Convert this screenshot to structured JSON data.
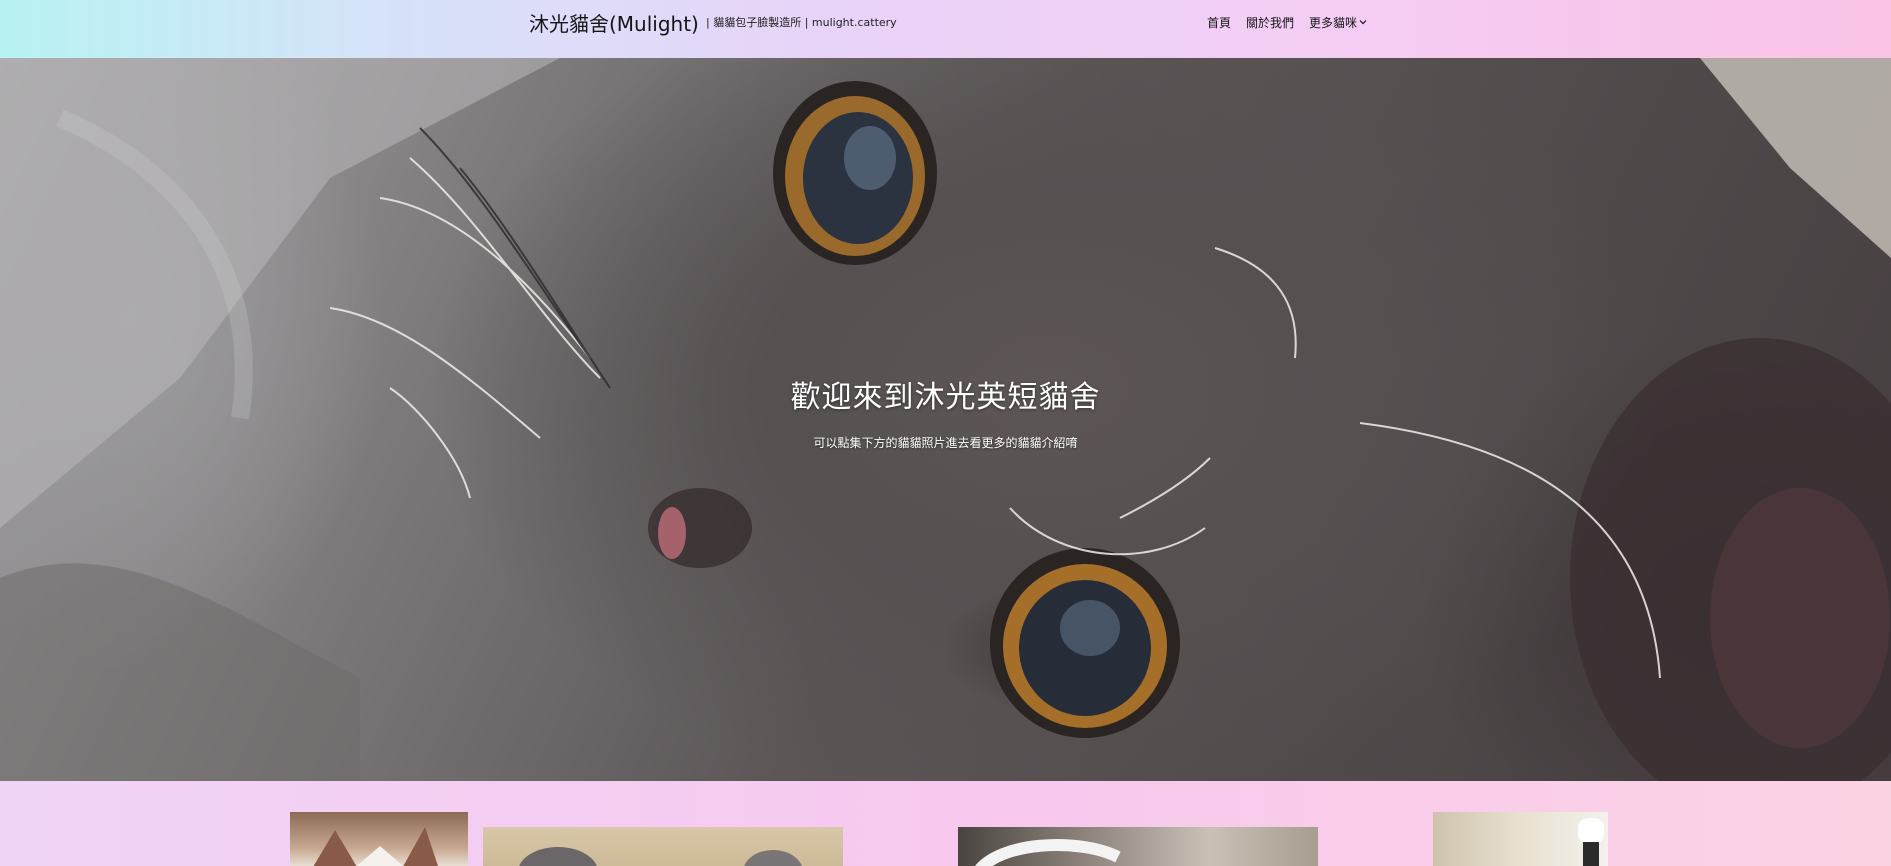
{
  "header": {
    "brand": "沐光貓舍(Mulight)",
    "tagline": "| 貓貓包子臉製造所 | mulight.cattery",
    "nav": {
      "home": "首頁",
      "about": "關於我們",
      "more_cats": "更多貓咪"
    }
  },
  "hero": {
    "title": "歡迎來到沐光英短貓舍",
    "subtitle": "可以點集下方的貓貓照片進去看更多的貓貓介紹唷"
  },
  "icons": {
    "more_cats_dropdown": "chevron-down-icon"
  },
  "colors": {
    "header_gradient_start": "#b8f3f3",
    "header_gradient_end": "#fbc3e6",
    "page_background": "#f8c8ee",
    "hero_text": "#ffffff"
  }
}
